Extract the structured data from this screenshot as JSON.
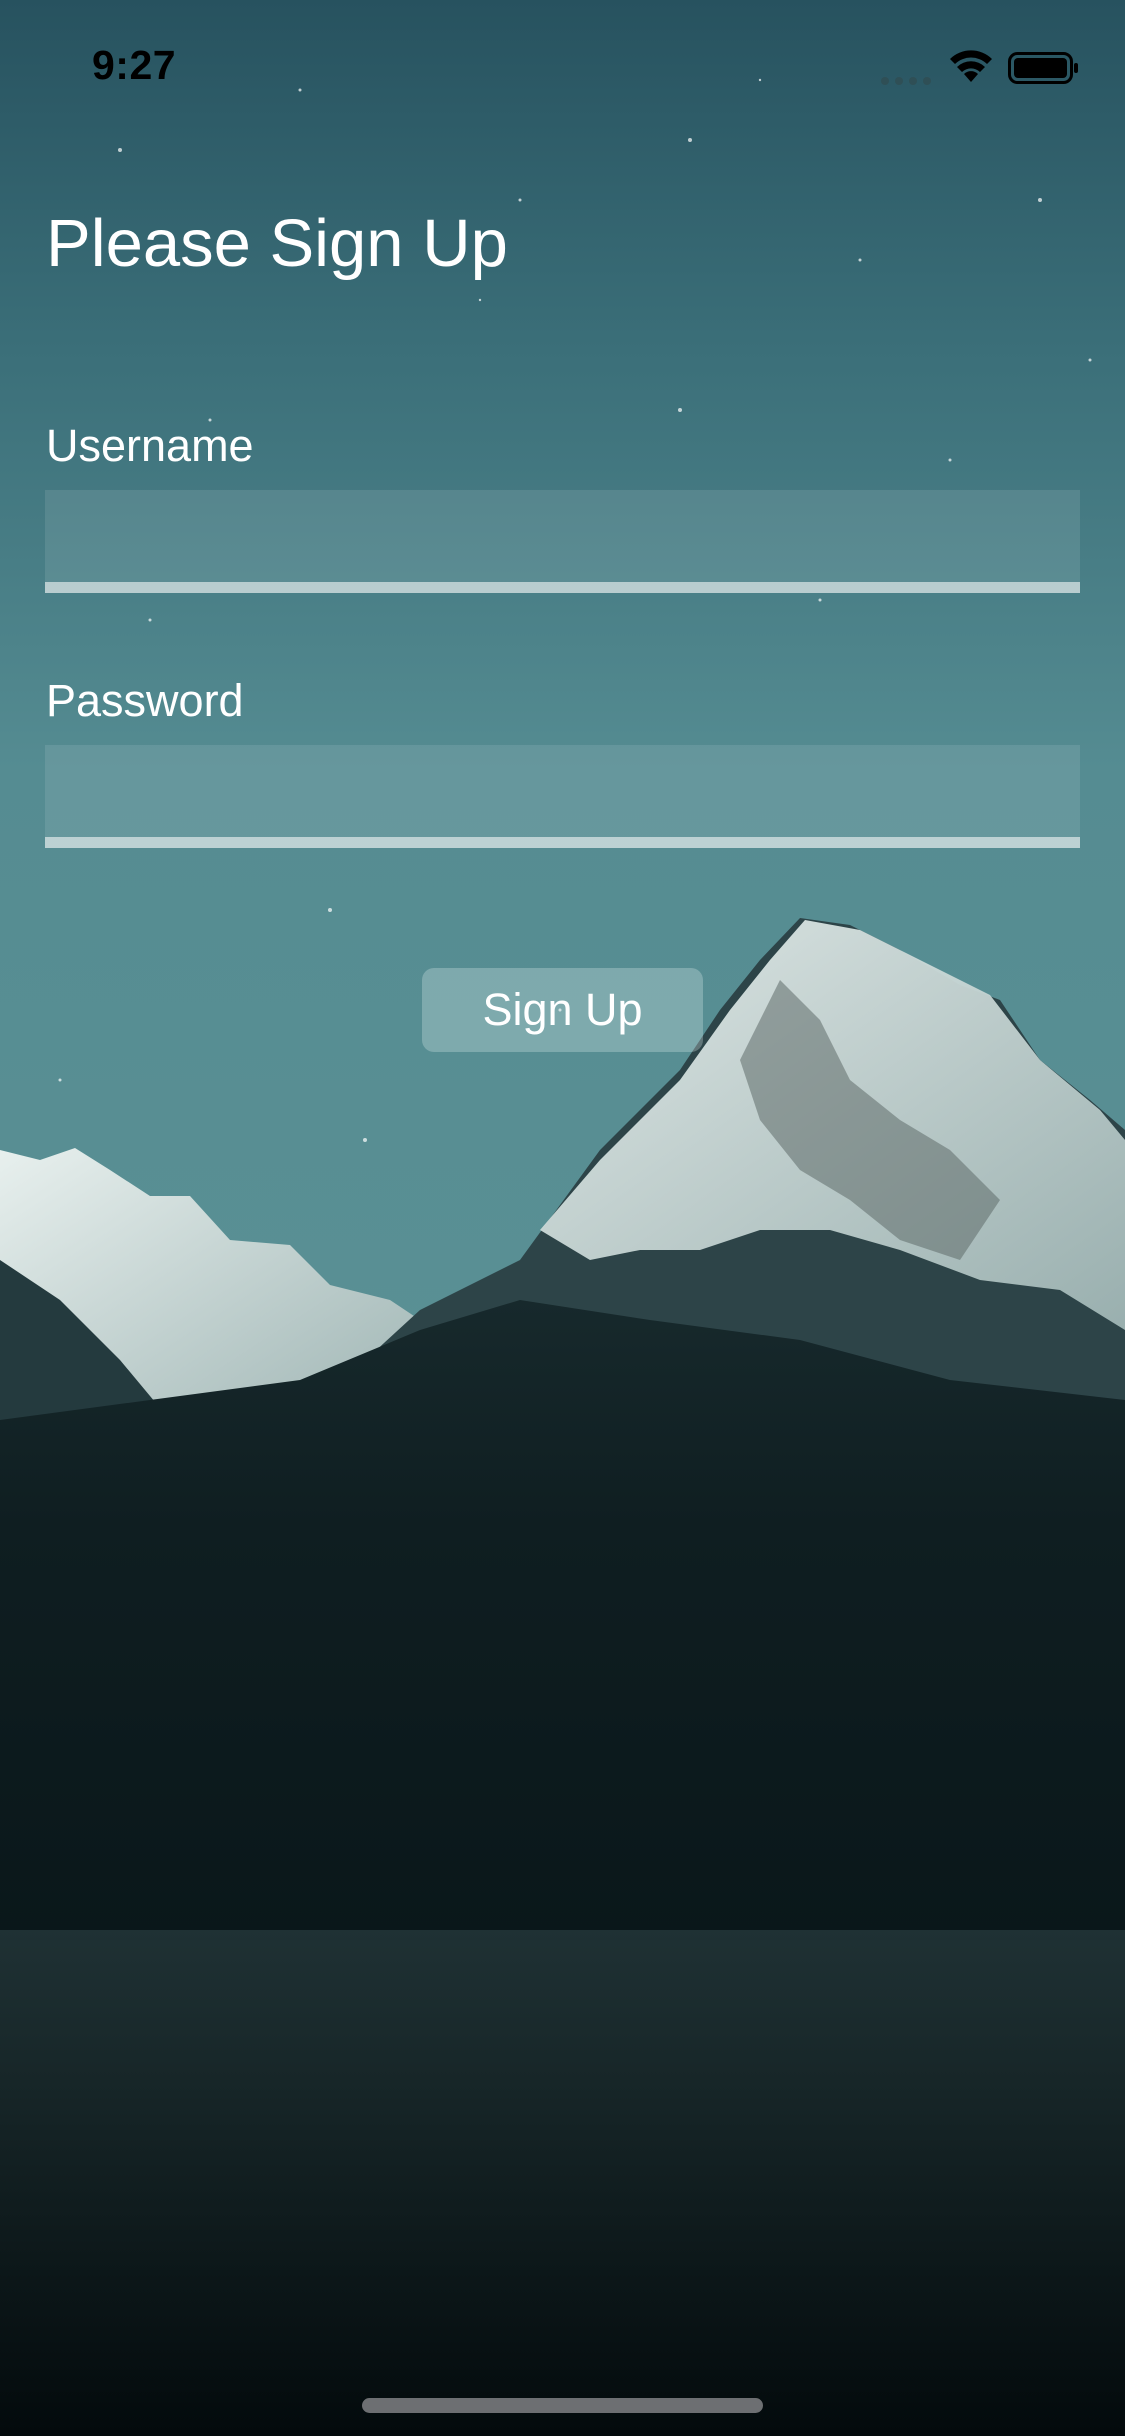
{
  "status_bar": {
    "time": "9:27",
    "icons": [
      "cellular-signal-icon",
      "wifi-icon",
      "battery-icon"
    ]
  },
  "page": {
    "title": "Please Sign Up"
  },
  "form": {
    "username": {
      "label": "Username",
      "value": "",
      "placeholder": ""
    },
    "password": {
      "label": "Password",
      "value": "",
      "placeholder": ""
    },
    "submit_label": "Sign Up"
  },
  "background": {
    "scene": "mountain-night-sky",
    "sky_color_top": "#275663",
    "sky_color_bottom": "#548a90",
    "ground_color": "#081418"
  },
  "colors": {
    "text": "#ffffff",
    "field_fill": "rgba(255,255,255,0.10)",
    "field_underline": "#c9d6d6",
    "button_fill": "rgba(220,235,235,0.30)"
  }
}
